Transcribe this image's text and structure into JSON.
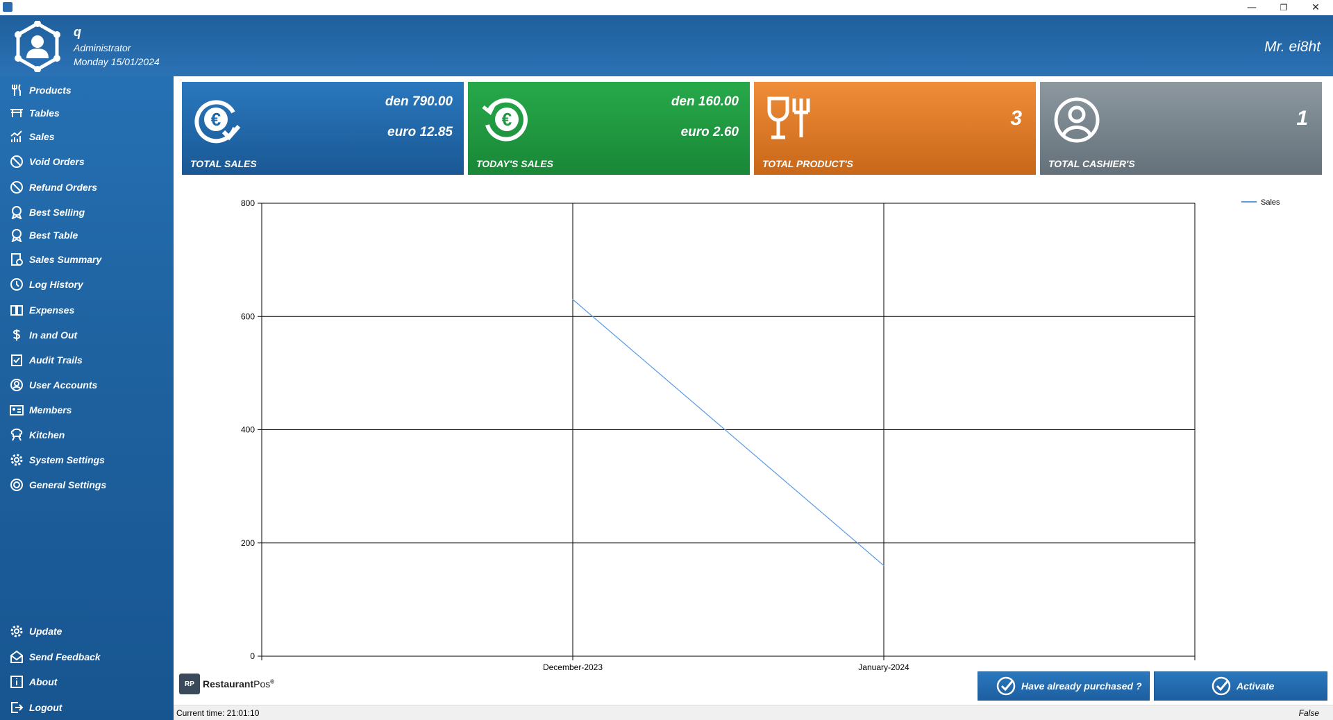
{
  "window": {
    "minimize_glyph": "—",
    "restore_glyph": "❐",
    "close_glyph": "✕"
  },
  "header": {
    "user_name": "q",
    "user_role": "Administrator",
    "date": "Monday 15/01/2024",
    "brand": "Mr. ei8ht"
  },
  "sidebar": {
    "items": [
      {
        "label": "Products",
        "icon": "fork-knife-icon"
      },
      {
        "label": "Tables",
        "icon": "table-icon"
      },
      {
        "label": "Sales",
        "icon": "chart-bars-icon"
      },
      {
        "label": "Void Orders",
        "icon": "ban-icon"
      },
      {
        "label": "Refund Orders",
        "icon": "ban-icon"
      },
      {
        "label": "Best Selling",
        "icon": "award-icon"
      },
      {
        "label": "Best Table",
        "icon": "award-icon"
      },
      {
        "label": "Sales Summary",
        "icon": "report-icon"
      },
      {
        "label": "Log History",
        "icon": "history-icon"
      },
      {
        "label": "Expenses",
        "icon": "book-icon"
      },
      {
        "label": "In and Out",
        "icon": "dollar-icon"
      },
      {
        "label": "Audit Trails",
        "icon": "checklist-icon"
      },
      {
        "label": "User Accounts",
        "icon": "user-circle-icon"
      },
      {
        "label": "Members",
        "icon": "id-card-icon"
      },
      {
        "label": "Kitchen",
        "icon": "chef-icon"
      },
      {
        "label": "System Settings",
        "icon": "gear-icon"
      },
      {
        "label": "General Settings",
        "icon": "settings-circle-icon"
      }
    ],
    "bottom_items": [
      {
        "label": "Update",
        "icon": "gear-icon"
      },
      {
        "label": "Send Feedback",
        "icon": "mail-icon"
      },
      {
        "label": "About",
        "icon": "info-icon"
      },
      {
        "label": "Logout",
        "icon": "logout-icon"
      }
    ]
  },
  "cards": [
    {
      "title": "TOTAL SALES",
      "line1": "den 790.00",
      "line2": "euro 12.85",
      "icon": "euro-check-icon",
      "color": "#1f67a8"
    },
    {
      "title": "TODAY'S SALES",
      "line1": "den 160.00",
      "line2": "euro 2.60",
      "icon": "euro-refresh-icon",
      "color": "#1f9a42"
    },
    {
      "title": "TOTAL PRODUCT'S",
      "value": "3",
      "icon": "fork-glass-icon",
      "color": "#e07b2a"
    },
    {
      "title": "TOTAL CASHIER'S",
      "value": "1",
      "icon": "user-circle-icon",
      "color": "#7a868e"
    }
  ],
  "chart_data": {
    "type": "line",
    "categories": [
      "December-2023",
      "January-2024"
    ],
    "series": [
      {
        "name": "Sales",
        "values": [
          630,
          160
        ],
        "color": "#5a9ae6"
      }
    ],
    "ylim": [
      0,
      800
    ],
    "yticks": [
      0,
      200,
      400,
      600,
      800
    ],
    "legend": "top-right",
    "grid": true
  },
  "footer": {
    "logo_mark": "RP",
    "logo_name": "Restaurant",
    "logo_suffix": "Pos",
    "logo_reg": "®",
    "btn_purchased": "Have already purchased ?",
    "btn_activate": "Activate",
    "status_time": "Current time: 21:01:10",
    "status_flag": "False"
  }
}
